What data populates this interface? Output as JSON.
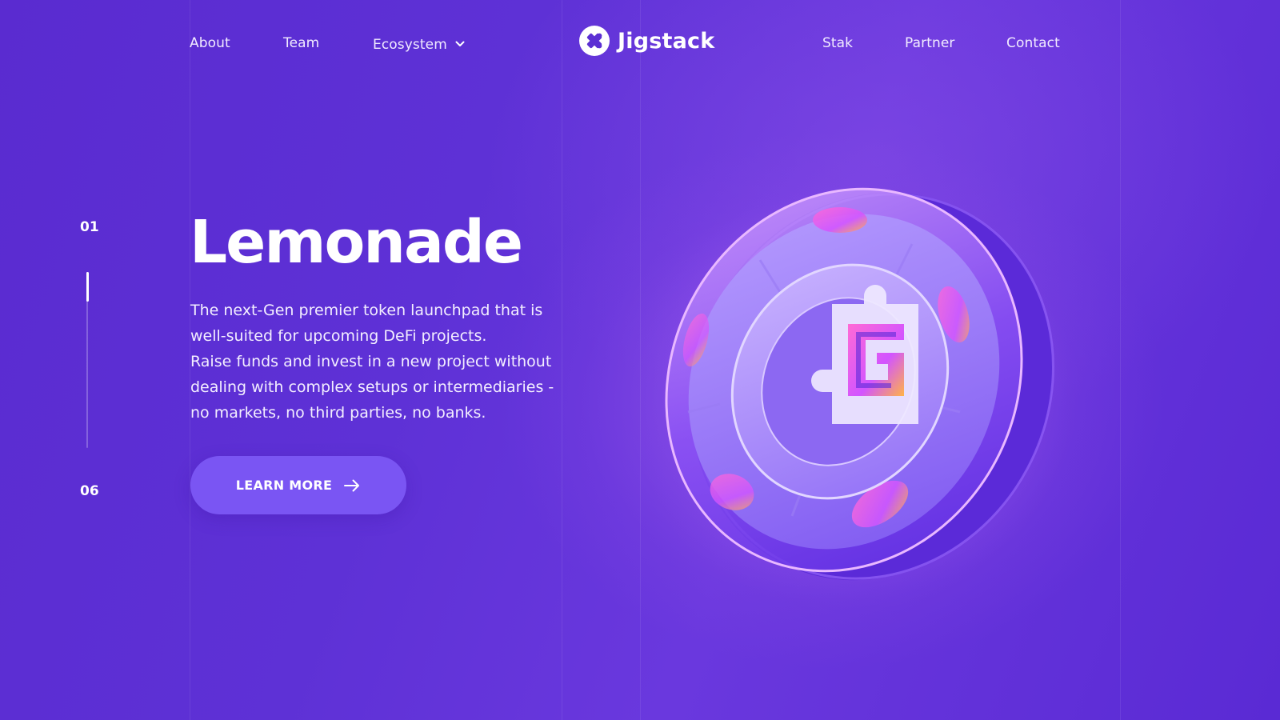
{
  "nav": {
    "left": [
      {
        "label": "About"
      },
      {
        "label": "Team"
      },
      {
        "label": "Ecosystem"
      }
    ],
    "right": [
      {
        "label": "Stak"
      },
      {
        "label": "Partner"
      },
      {
        "label": "Contact"
      }
    ],
    "ecosystem_icon": "chevron-down-icon"
  },
  "brand": {
    "name": "Jigstack",
    "icon": "puzzle-icon"
  },
  "slider": {
    "current": "01",
    "total": "06",
    "progress": 0.17
  },
  "hero": {
    "title": "Lemonade",
    "description_lines": [
      "The next-Gen premier token launchpad that is well-suited for upcoming DeFi projects.",
      "Raise funds and invest in a new project without dealing with complex setups or intermediaries - no markets, no third parties, no banks."
    ],
    "cta_label": "LEARN MORE",
    "cta_icon": "arrow-right-icon"
  },
  "colors": {
    "background": "#5e31d6",
    "button": "#7a55f3",
    "text": "#ffffff"
  }
}
